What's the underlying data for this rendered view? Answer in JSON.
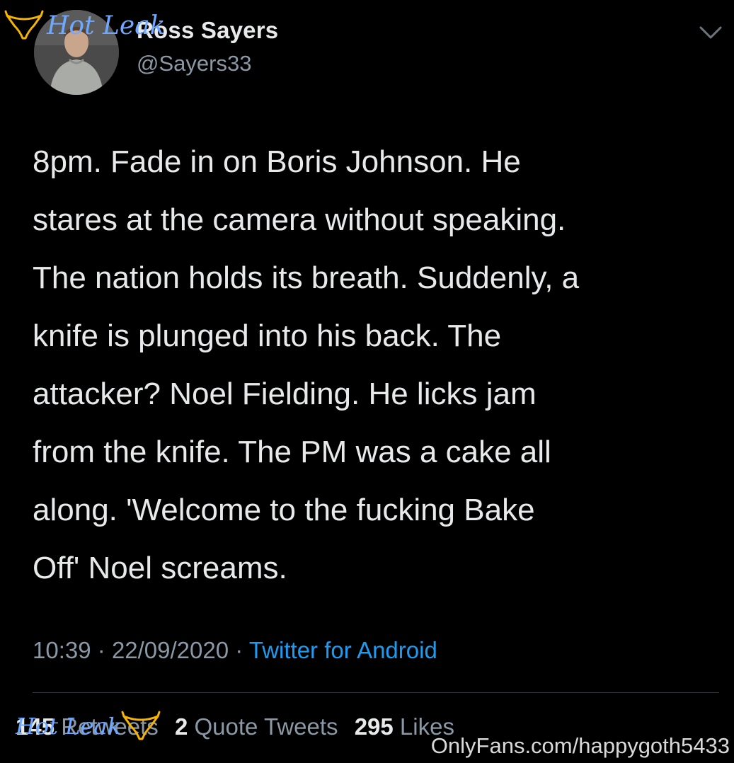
{
  "author": {
    "display_name": "Ross Sayers",
    "handle": "@Sayers33"
  },
  "tweet": {
    "text": "8pm. Fade in on Boris Johnson. He\nstares at the camera without speaking.\nThe nation holds its breath. Suddenly, a\nknife is plunged into his back. The\nattacker? Noel Fielding. He licks jam\nfrom the knife. The PM was a cake all\nalong. 'Welcome to the fucking Bake\nOff' Noel screams.",
    "time": "10:39",
    "separator": "·",
    "date": "22/09/2020",
    "source": "Twitter for Android"
  },
  "stats": {
    "retweets_count": "145",
    "retweets_label": "Retweets",
    "quotes_count": "2",
    "quotes_label": "Quote Tweets",
    "likes_count": "295",
    "likes_label": "Likes"
  },
  "watermarks": {
    "top_left": "Hot Leak",
    "bottom_left": "Hot Leak",
    "bottom_right": "OnlyFans.com/happygoth5433"
  },
  "icons": {
    "menu": "chevron-down-icon",
    "watermark": "lingerie-icon"
  },
  "colors": {
    "background": "#000000",
    "text_primary": "#e7e9ea",
    "text_secondary": "#8b98a5",
    "link": "#1d9bf0",
    "watermark": "#6fa8ff"
  }
}
